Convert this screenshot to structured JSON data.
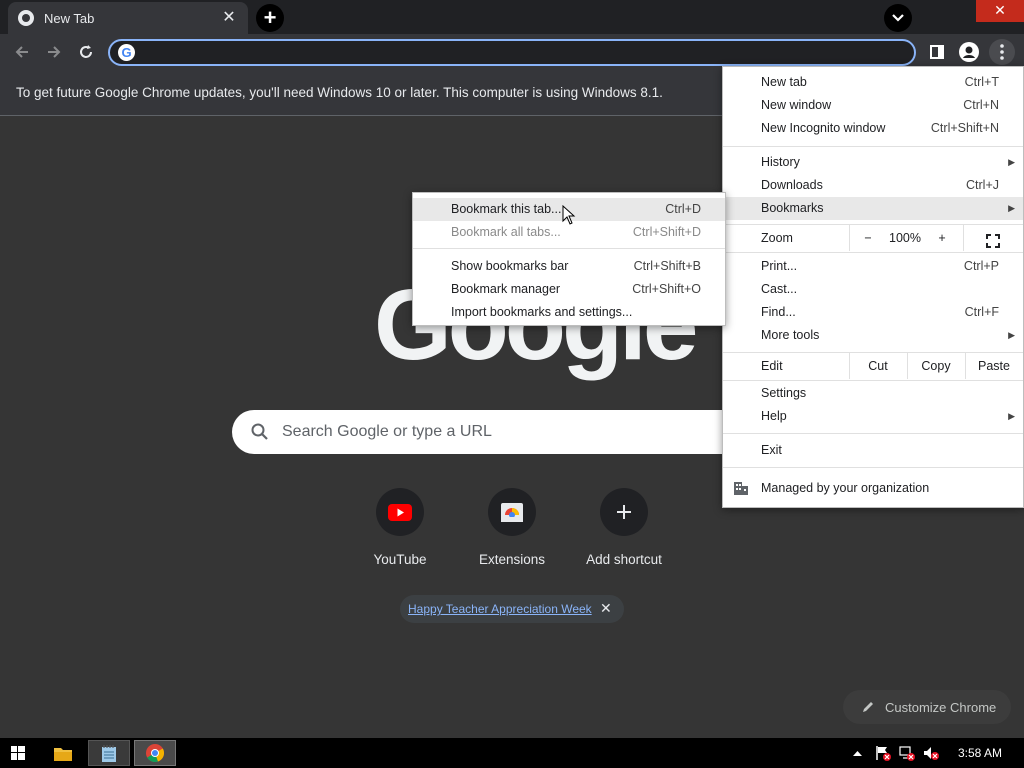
{
  "tab": {
    "title": "New Tab",
    "close": "✕"
  },
  "newtab_button": "+",
  "window_close": "✕",
  "omnibox": {
    "value": "",
    "logo": "G"
  },
  "infobar": {
    "text": "To get future Google Chrome updates, you'll need Windows 10 or later. This computer is using Windows 8.1."
  },
  "ntp": {
    "logo": "Google",
    "search_placeholder": "Search Google or type a URL",
    "shortcuts": [
      {
        "label": "YouTube",
        "icon": "youtube-icon"
      },
      {
        "label": "Extensions",
        "icon": "chrome-web-store-icon"
      },
      {
        "label": "Add shortcut",
        "icon": "plus-icon"
      }
    ],
    "promo": {
      "text": "Happy Teacher Appreciation Week",
      "close": "✕"
    },
    "customize_label": "Customize Chrome"
  },
  "main_menu": {
    "new_tab": {
      "label": "New tab",
      "shortcut": "Ctrl+T"
    },
    "new_window": {
      "label": "New window",
      "shortcut": "Ctrl+N"
    },
    "new_incognito": {
      "label": "New Incognito window",
      "shortcut": "Ctrl+Shift+N"
    },
    "history": {
      "label": "History"
    },
    "downloads": {
      "label": "Downloads",
      "shortcut": "Ctrl+J"
    },
    "bookmarks": {
      "label": "Bookmarks"
    },
    "zoom": {
      "label": "Zoom",
      "minus": "−",
      "value": "100%",
      "plus": "+"
    },
    "print": {
      "label": "Print...",
      "shortcut": "Ctrl+P"
    },
    "cast": {
      "label": "Cast..."
    },
    "find": {
      "label": "Find...",
      "shortcut": "Ctrl+F"
    },
    "more_tools": {
      "label": "More tools"
    },
    "edit": {
      "label": "Edit",
      "cut": "Cut",
      "copy": "Copy",
      "paste": "Paste"
    },
    "settings": {
      "label": "Settings"
    },
    "help": {
      "label": "Help"
    },
    "exit": {
      "label": "Exit"
    },
    "managed": {
      "label": "Managed by your organization"
    }
  },
  "bookmarks_menu": {
    "bookmark_tab": {
      "label": "Bookmark this tab...",
      "shortcut": "Ctrl+D"
    },
    "bookmark_all": {
      "label": "Bookmark all tabs...",
      "shortcut": "Ctrl+Shift+D"
    },
    "show_bar": {
      "label": "Show bookmarks bar",
      "shortcut": "Ctrl+Shift+B"
    },
    "manager": {
      "label": "Bookmark manager",
      "shortcut": "Ctrl+Shift+O"
    },
    "import": {
      "label": "Import bookmarks and settings..."
    }
  },
  "taskbar": {
    "clock": "3:58 AM"
  },
  "colors": {
    "accent": "#8ab4f8",
    "background": "#353535",
    "youtube_red": "#ff0000",
    "close_red": "#c42b1c"
  }
}
